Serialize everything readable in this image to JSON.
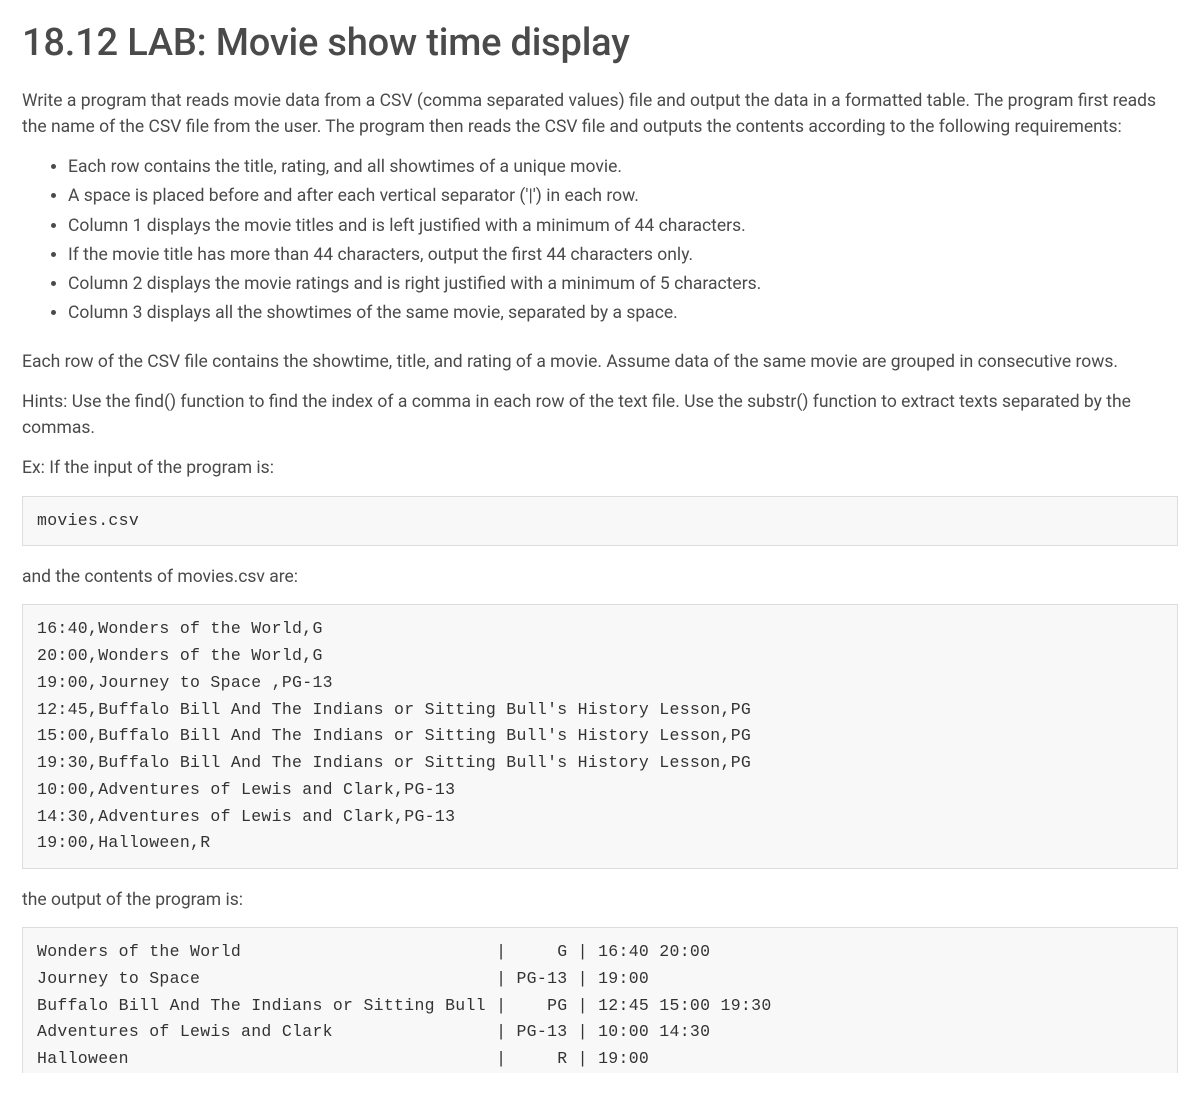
{
  "title": "18.12 LAB: Movie show time display",
  "intro_paragraph": "Write a program that reads movie data from a CSV (comma separated values) file and output the data in a formatted table. The program first reads the name of the CSV file from the user. The program then reads the CSV file and outputs the contents according to the following requirements:",
  "requirements": [
    "Each row contains the title, rating, and all showtimes of a unique movie.",
    "A space is placed before and after each vertical separator ('|') in each row.",
    "Column 1 displays the movie titles and is left justified with a minimum of 44 characters.",
    "If the movie title has more than 44 characters, output the first 44 characters only.",
    "Column 2 displays the movie ratings and is right justified with a minimum of 5 characters.",
    "Column 3 displays all the showtimes of the same movie, separated by a space."
  ],
  "paragraph_csv_info": "Each row of the CSV file contains the showtime, title, and rating of a movie. Assume data of the same movie are grouped in consecutive rows.",
  "paragraph_hints": "Hints: Use the find() function to find the index of a comma in each row of the text file. Use the substr() function to extract texts separated by the commas.",
  "paragraph_example_intro": "Ex: If the input of the program is:",
  "input_block": "movies.csv",
  "paragraph_csv_contents_intro": "and the contents of movies.csv are:",
  "csv_block": "16:40,Wonders of the World,G\n20:00,Wonders of the World,G\n19:00,Journey to Space ,PG-13\n12:45,Buffalo Bill And The Indians or Sitting Bull's History Lesson,PG\n15:00,Buffalo Bill And The Indians or Sitting Bull's History Lesson,PG\n19:30,Buffalo Bill And The Indians or Sitting Bull's History Lesson,PG\n10:00,Adventures of Lewis and Clark,PG-13\n14:30,Adventures of Lewis and Clark,PG-13\n19:00,Halloween,R",
  "paragraph_output_intro": "the output of the program is:",
  "output_block": "Wonders of the World                         |     G | 16:40 20:00\nJourney to Space                             | PG-13 | 19:00\nBuffalo Bill And The Indians or Sitting Bull |    PG | 12:45 15:00 19:30\nAdventures of Lewis and Clark                | PG-13 | 10:00 14:30\nHalloween                                    |     R | 19:00"
}
